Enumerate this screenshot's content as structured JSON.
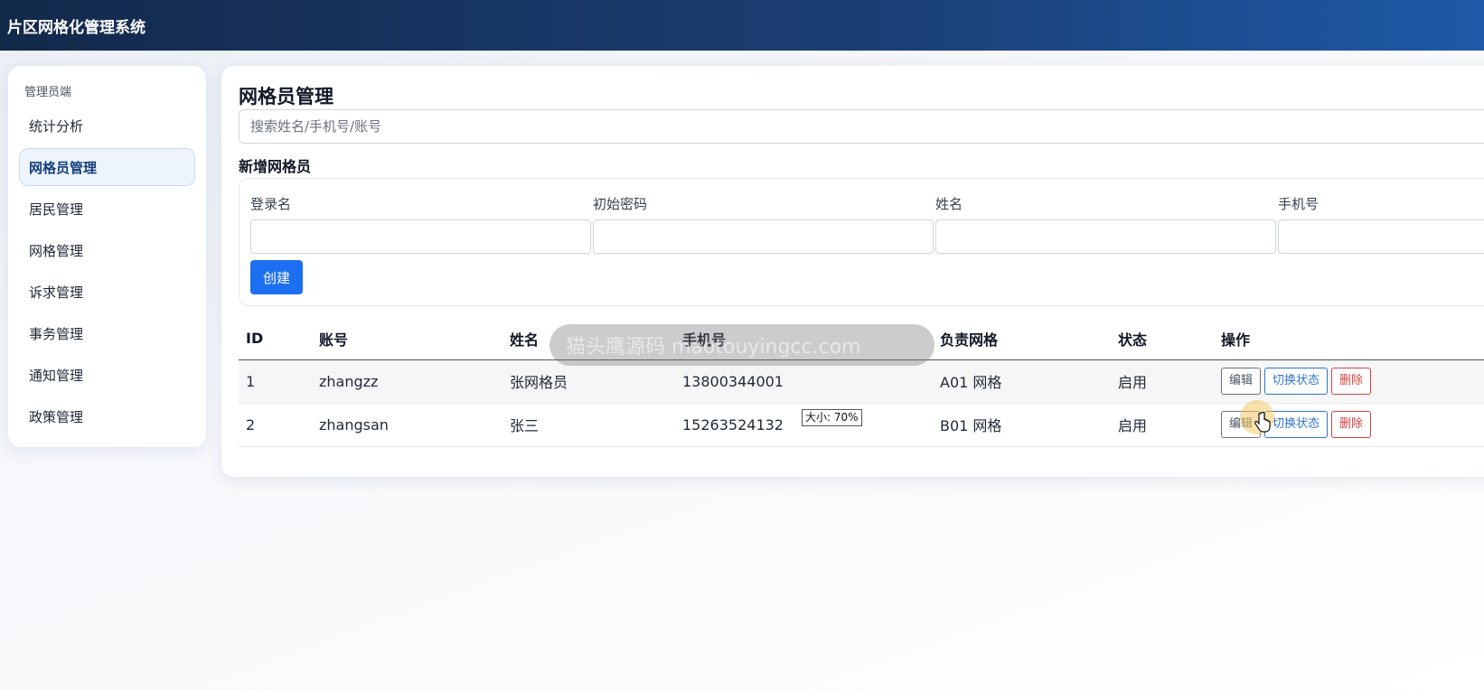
{
  "app": {
    "title": "片区网格化管理系统"
  },
  "sidebar": {
    "section": "管理员端",
    "items": [
      {
        "label": "统计分析"
      },
      {
        "label": "网格员管理",
        "active": true
      },
      {
        "label": "居民管理"
      },
      {
        "label": "网格管理"
      },
      {
        "label": "诉求管理"
      },
      {
        "label": "事务管理"
      },
      {
        "label": "通知管理"
      },
      {
        "label": "政策管理"
      }
    ]
  },
  "main": {
    "title": "网格员管理",
    "search": {
      "placeholder": "搜索姓名/手机号/账号",
      "value": ""
    },
    "create_form": {
      "title": "新增网格员",
      "fields": [
        {
          "label": "登录名",
          "value": ""
        },
        {
          "label": "初始密码",
          "value": ""
        },
        {
          "label": "姓名",
          "value": ""
        },
        {
          "label": "手机号",
          "value": ""
        }
      ],
      "submit_label": "创建"
    },
    "table": {
      "columns": [
        "ID",
        "账号",
        "姓名",
        "手机号",
        "负责网格",
        "状态",
        "操作"
      ],
      "rows": [
        {
          "id": "1",
          "account": "zhangzz",
          "name": "张网格员",
          "phone": "13800344001",
          "grid": "A01 网格",
          "status": "启用"
        },
        {
          "id": "2",
          "account": "zhangsan",
          "name": "张三",
          "phone": "15263524132",
          "grid": "B01 网格",
          "status": "启用"
        }
      ],
      "actions": {
        "edit": "编辑",
        "toggle": "切换状态",
        "delete": "删除"
      }
    }
  },
  "overlay": {
    "watermark": "猫头鹰源码 maotouyingcc.com",
    "zoom_tip": "大小: 70%"
  },
  "colors": {
    "topbar_start": "#13294b",
    "topbar_end": "#1e5aa8",
    "primary": "#1d6ff2",
    "danger": "#d14343",
    "toggle": "#2f74d0"
  }
}
